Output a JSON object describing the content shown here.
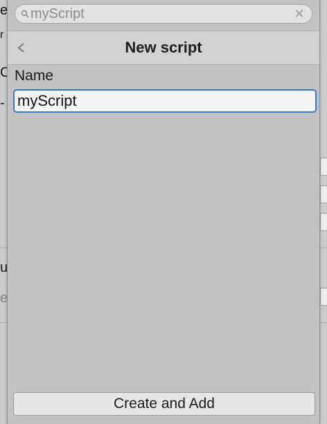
{
  "search": {
    "value": "myScript"
  },
  "header": {
    "title": "New script"
  },
  "form": {
    "name_label": "Name",
    "name_value": "myScript"
  },
  "actions": {
    "create_label": "Create and Add"
  },
  "background": {
    "left_fragments": [
      "e",
      "r",
      "C",
      "-",
      "u",
      "e"
    ]
  },
  "colors": {
    "popup_bg": "#c2c2c2",
    "focus_border": "#3a79c6",
    "header_bg": "#d2d2d2"
  }
}
